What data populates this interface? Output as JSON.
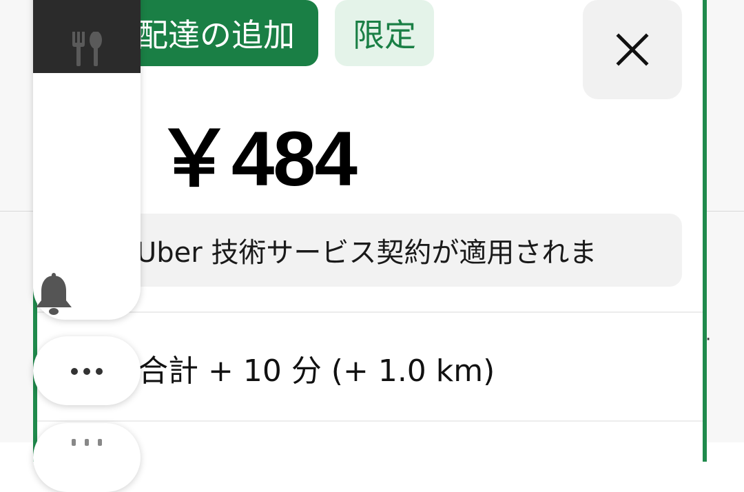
{
  "offer": {
    "chip_primary": "配達の追加",
    "chip_secondary": "限定",
    "price": "￥484",
    "notice": "Uber 技術サービス契約が適用されま",
    "trip_summary": "合計 + 10 分 (+ 1.0 km)"
  },
  "icons": {
    "close": "close-icon",
    "restaurant": "fork-knife-icon",
    "bell": "bell-icon",
    "more": "more-horizontal-icon"
  },
  "colors": {
    "accent_green": "#1a7f45",
    "chip_light_green": "#e4f3e9",
    "card_border": "#1f8a4c"
  }
}
